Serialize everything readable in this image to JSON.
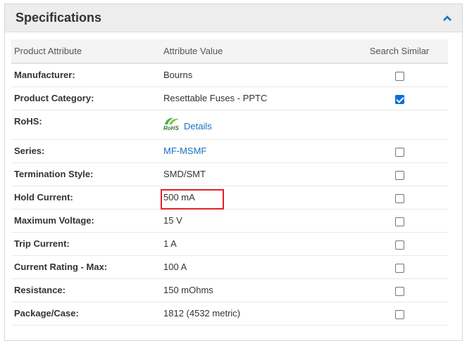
{
  "panel": {
    "title": "Specifications",
    "collapse_icon": "chevron-up-icon",
    "accent_color": "#1a6fc4"
  },
  "table": {
    "headers": {
      "attribute": "Product Attribute",
      "value": "Attribute Value",
      "search": "Search Similar"
    },
    "rows": [
      {
        "attribute": "Manufacturer:",
        "value": "Bourns",
        "checked": false
      },
      {
        "attribute": "Product Category:",
        "value": "Resettable Fuses - PPTC",
        "checked": true
      },
      {
        "attribute": "RoHS:",
        "value": "Details",
        "rohs_logo_text": "RoHS"
      },
      {
        "attribute": "Series:",
        "value": "MF-MSMF",
        "checked": false
      },
      {
        "attribute": "Termination Style:",
        "value": "SMD/SMT",
        "checked": false
      },
      {
        "attribute": "Hold Current:",
        "value": "500 mA",
        "checked": false
      },
      {
        "attribute": "Maximum Voltage:",
        "value": "15 V",
        "checked": false
      },
      {
        "attribute": "Trip Current:",
        "value": "1 A",
        "checked": false
      },
      {
        "attribute": "Current Rating - Max:",
        "value": "100 A",
        "checked": false
      },
      {
        "attribute": "Resistance:",
        "value": "150 mOhms",
        "checked": false
      },
      {
        "attribute": "Package/Case:",
        "value": "1812 (4532 metric)",
        "checked": false
      }
    ]
  }
}
